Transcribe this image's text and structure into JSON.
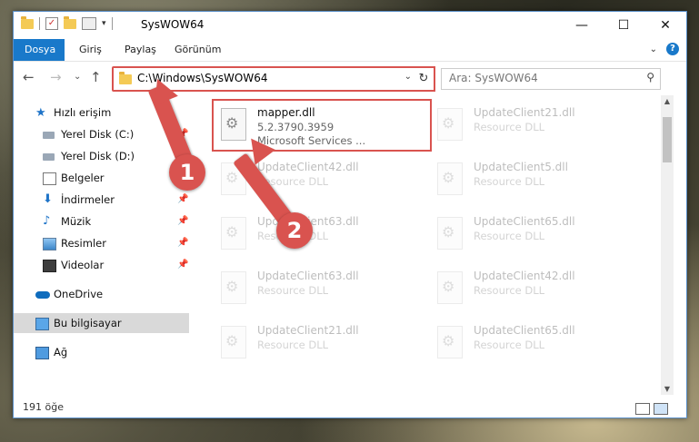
{
  "window": {
    "title": "SysWOW64"
  },
  "ribbon": {
    "tabs": [
      "Dosya",
      "Giriş",
      "Paylaş",
      "Görünüm"
    ]
  },
  "address": {
    "path": "C:\\Windows\\SysWOW64",
    "search_placeholder": "Ara: SysWOW64"
  },
  "nav": {
    "items": [
      {
        "label": "Hızlı erişim",
        "icon": "star-icon"
      },
      {
        "label": "Yerel Disk (C:)",
        "icon": "drive-icon"
      },
      {
        "label": "Yerel Disk (D:)",
        "icon": "drive-icon"
      },
      {
        "label": "Belgeler",
        "icon": "documents-icon"
      },
      {
        "label": "İndirmeler",
        "icon": "download-icon"
      },
      {
        "label": "Müzik",
        "icon": "music-icon"
      },
      {
        "label": "Resimler",
        "icon": "pictures-icon"
      },
      {
        "label": "Videolar",
        "icon": "video-icon"
      },
      {
        "label": "OneDrive",
        "icon": "cloud-icon"
      },
      {
        "label": "Bu bilgisayar",
        "icon": "computer-icon"
      },
      {
        "label": "Ağ",
        "icon": "network-icon"
      }
    ]
  },
  "files": [
    {
      "name": "mapper.dll",
      "line1": "5.2.3790.3959",
      "line2": "Microsoft Services ..."
    },
    {
      "name": "UpdateClient21.dll",
      "line1": "Resource DLL"
    },
    {
      "name": "UpdateClient42.dll",
      "line1": "Resource DLL"
    },
    {
      "name": "UpdateClient5.dll",
      "line1": "Resource DLL"
    },
    {
      "name": "UpdateClient63.dll",
      "line1": "Resource DLL"
    },
    {
      "name": "UpdateClient65.dll",
      "line1": "Resource DLL"
    },
    {
      "name": "UpdateClient63.dll",
      "line1": "Resource DLL"
    },
    {
      "name": "UpdateClient42.dll",
      "line1": "Resource DLL"
    },
    {
      "name": "UpdateClient21.dll",
      "line1": "Resource DLL"
    },
    {
      "name": "UpdateClient65.dll",
      "line1": "Resource DLL"
    }
  ],
  "status": {
    "count": "191 öğe"
  },
  "annotations": {
    "step1": "1",
    "step2": "2"
  },
  "colors": {
    "accent": "#1979ca",
    "highlight": "#d9534f"
  }
}
